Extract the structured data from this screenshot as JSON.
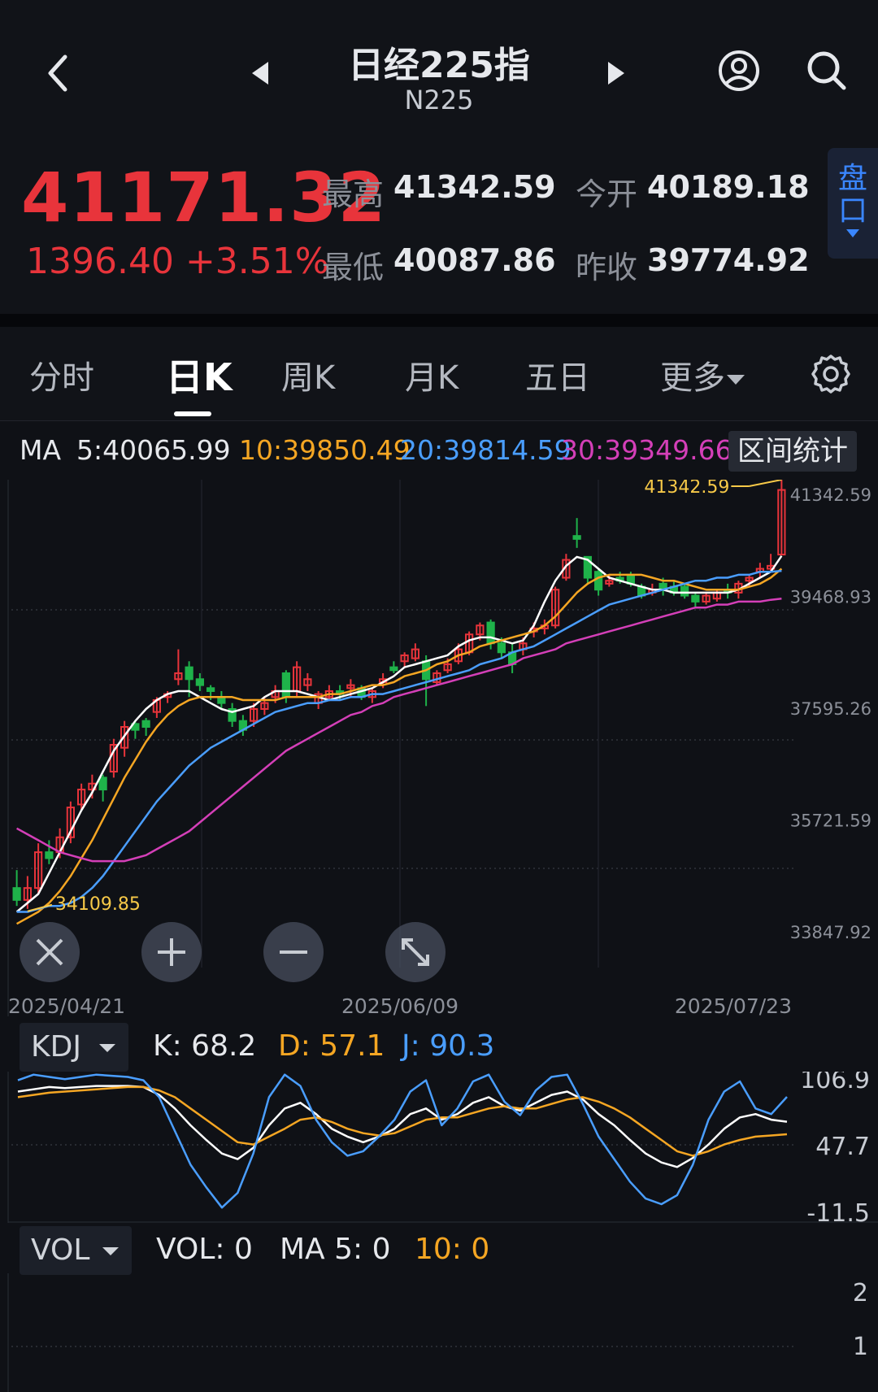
{
  "header": {
    "title": "日经225指",
    "subtitle": "N225"
  },
  "quote": {
    "price": "41171.32",
    "change": "1396.40 +3.51%",
    "high_label": "最高",
    "high": "41342.59",
    "low_label": "最低",
    "low": "40087.86",
    "open_label": "今开",
    "open": "40189.18",
    "prev_label": "昨收",
    "prev": "39774.92",
    "panko_label": "盘口"
  },
  "tabs": [
    "分时",
    "日K",
    "周K",
    "月K",
    "五日",
    "更多"
  ],
  "active_tab": "日K",
  "ma": {
    "label": "MA",
    "ma5": "5:40065.99",
    "ma10": "10:39850.49",
    "ma20": "20:39814.59",
    "ma30": "30:39349.66",
    "range_button": "区间统计"
  },
  "colors": {
    "up": "#e8343b",
    "down": "#1fb34a",
    "ma5": "#ffffff",
    "ma10": "#f5a623",
    "ma20": "#4a9eff",
    "ma30": "#d43fb8",
    "highlight": "#f7c948"
  },
  "icons": [
    "back-icon",
    "prev-arrow-icon",
    "next-arrow-icon",
    "user-icon",
    "search-icon",
    "gear-icon",
    "reset-zoom-icon",
    "zoom-in-icon",
    "zoom-out-icon",
    "fullscreen-icon"
  ],
  "chart_data": [
    {
      "type": "candlestick",
      "title": "日K",
      "y_tick_labels": [
        "41342.59",
        "39468.93",
        "37595.26",
        "35721.59",
        "33847.92"
      ],
      "ylim": [
        33847.92,
        41342.59
      ],
      "x_tick_labels": [
        "2025/04/21",
        "2025/06/09",
        "2025/07/23"
      ],
      "max_label": "41342.59",
      "min_label": "34109.85",
      "candles": [
        [
          34500,
          34300,
          34800,
          34200
        ],
        [
          34300,
          34500,
          34700,
          34150
        ],
        [
          34500,
          35100,
          35250,
          34400
        ],
        [
          35100,
          35000,
          35300,
          34900
        ],
        [
          35100,
          35350,
          35500,
          35000
        ],
        [
          35350,
          35850,
          35950,
          35250
        ],
        [
          35900,
          36150,
          36250,
          35800
        ],
        [
          36150,
          36250,
          36400,
          36000
        ],
        [
          36350,
          36150,
          36400,
          35950
        ],
        [
          36450,
          36900,
          37000,
          36350
        ],
        [
          36850,
          37200,
          37300,
          36700
        ],
        [
          37250,
          37150,
          37300,
          37000
        ],
        [
          37300,
          37200,
          37350,
          37050
        ],
        [
          37450,
          37650,
          37700,
          37350
        ],
        [
          37700,
          37750,
          37800,
          37600
        ],
        [
          38000,
          38100,
          38500,
          37900
        ],
        [
          38200,
          38000,
          38300,
          37700
        ],
        [
          38000,
          37900,
          38100,
          37800
        ],
        [
          37850,
          37800,
          37900,
          37650
        ],
        [
          37700,
          37600,
          37800,
          37500
        ],
        [
          37500,
          37300,
          37600,
          37200
        ],
        [
          37300,
          37150,
          37400,
          37050
        ],
        [
          37300,
          37500,
          37600,
          37200
        ],
        [
          37500,
          37600,
          37700,
          37400
        ],
        [
          37700,
          37800,
          37900,
          37600
        ],
        [
          38100,
          37700,
          38150,
          37600
        ],
        [
          37800,
          38200,
          38300,
          37700
        ],
        [
          37900,
          38000,
          38100,
          37800
        ],
        [
          37600,
          37750,
          37800,
          37500
        ],
        [
          37700,
          37800,
          37900,
          37650
        ],
        [
          37800,
          37750,
          37900,
          37650
        ],
        [
          37850,
          37900,
          38000,
          37700
        ],
        [
          37850,
          37700,
          37900,
          37650
        ],
        [
          37700,
          37800,
          37850,
          37600
        ],
        [
          37950,
          38000,
          38100,
          37850
        ],
        [
          38200,
          38150,
          38300,
          38100
        ],
        [
          38300,
          38400,
          38450,
          38200
        ],
        [
          38350,
          38500,
          38600,
          38300
        ],
        [
          38300,
          38000,
          38400,
          37550
        ],
        [
          37950,
          38100,
          38150,
          37900
        ],
        [
          38150,
          38250,
          38350,
          38100
        ],
        [
          38300,
          38500,
          38600,
          38250
        ],
        [
          38450,
          38750,
          38800,
          38400
        ],
        [
          38750,
          38900,
          38950,
          38650
        ],
        [
          38950,
          38600,
          39000,
          38500
        ],
        [
          38600,
          38450,
          38700,
          38350
        ],
        [
          38450,
          38250,
          38600,
          38100
        ],
        [
          38500,
          38600,
          38700,
          38400
        ],
        [
          38800,
          38850,
          38950,
          38700
        ],
        [
          38850,
          38900,
          39000,
          38750
        ],
        [
          38900,
          39500,
          39550,
          38850
        ],
        [
          39700,
          40000,
          40100,
          39650
        ],
        [
          40400,
          40350,
          40700,
          40200
        ],
        [
          40050,
          39700,
          40050,
          39600
        ],
        [
          39800,
          39500,
          39850,
          39400
        ],
        [
          39600,
          39650,
          39750,
          39550
        ],
        [
          39700,
          39650,
          39800,
          39600
        ],
        [
          39750,
          39600,
          39800,
          39550
        ],
        [
          39550,
          39400,
          39600,
          39350
        ],
        [
          39450,
          39500,
          39600,
          39400
        ],
        [
          39600,
          39500,
          39700,
          39400
        ],
        [
          39550,
          39450,
          39650,
          39400
        ],
        [
          39550,
          39400,
          39600,
          39350
        ],
        [
          39400,
          39300,
          39450,
          39200
        ],
        [
          39300,
          39400,
          39450,
          39250
        ],
        [
          39350,
          39450,
          39500,
          39300
        ],
        [
          39500,
          39450,
          39600,
          39350
        ],
        [
          39450,
          39600,
          39650,
          39350
        ],
        [
          39650,
          39700,
          39750,
          39550
        ],
        [
          39800,
          39850,
          39950,
          39700
        ],
        [
          39850,
          39900,
          40100,
          39800
        ],
        [
          40087.86,
          41171.32,
          41342.59,
          40087.86
        ]
      ],
      "series": [
        {
          "name": "MA5",
          "values": [
            34100,
            34250,
            34400,
            34750,
            35100,
            35450,
            35800,
            36100,
            36450,
            36800,
            37050,
            37300,
            37500,
            37650,
            37750,
            37800,
            37800,
            37700,
            37600,
            37500,
            37450,
            37500,
            37550,
            37700,
            37800,
            37800,
            37800,
            37750,
            37700,
            37650,
            37700,
            37750,
            37800,
            37850,
            37950,
            38050,
            38200,
            38250,
            38300,
            38350,
            38400,
            38550,
            38650,
            38700,
            38700,
            38650,
            38600,
            38650,
            38900,
            39300,
            39650,
            39900,
            40050,
            40000,
            39850,
            39700,
            39650,
            39600,
            39550,
            39500,
            39500,
            39450,
            39450,
            39450,
            39450,
            39450,
            39450,
            39500,
            39600,
            39700,
            39800,
            40065.99
          ]
        },
        {
          "name": "MA10",
          "values": [
            33900,
            34000,
            34100,
            34250,
            34450,
            34700,
            35000,
            35300,
            35650,
            36000,
            36350,
            36650,
            36950,
            37200,
            37400,
            37550,
            37650,
            37700,
            37700,
            37700,
            37700,
            37650,
            37650,
            37650,
            37650,
            37700,
            37700,
            37700,
            37700,
            37750,
            37750,
            37800,
            37850,
            37900,
            37900,
            37950,
            38050,
            38100,
            38150,
            38250,
            38300,
            38400,
            38450,
            38550,
            38600,
            38650,
            38700,
            38750,
            38800,
            38900,
            39050,
            39250,
            39450,
            39600,
            39700,
            39750,
            39750,
            39750,
            39750,
            39700,
            39650,
            39650,
            39600,
            39550,
            39500,
            39500,
            39500,
            39500,
            39550,
            39600,
            39700,
            39850.49
          ]
        },
        {
          "name": "MA20",
          "values": [
            34100,
            34100,
            34150,
            34200,
            34200,
            34250,
            34350,
            34500,
            34700,
            34950,
            35200,
            35450,
            35700,
            35950,
            36150,
            36350,
            36550,
            36700,
            36850,
            36950,
            37050,
            37150,
            37250,
            37350,
            37450,
            37500,
            37550,
            37600,
            37600,
            37650,
            37650,
            37700,
            37700,
            37750,
            37750,
            37800,
            37850,
            37900,
            37950,
            38000,
            38050,
            38100,
            38150,
            38250,
            38300,
            38350,
            38450,
            38500,
            38550,
            38650,
            38750,
            38850,
            38950,
            39050,
            39150,
            39250,
            39300,
            39350,
            39400,
            39450,
            39500,
            39550,
            39600,
            39650,
            39650,
            39700,
            39700,
            39750,
            39750,
            39800,
            39800,
            39814.59
          ]
        },
        {
          "name": "MA30",
          "values": [
            35500,
            35400,
            35300,
            35200,
            35100,
            35050,
            35000,
            34950,
            34950,
            34950,
            34950,
            35000,
            35050,
            35150,
            35250,
            35350,
            35450,
            35600,
            35750,
            35900,
            36050,
            36200,
            36350,
            36500,
            36650,
            36800,
            36900,
            37000,
            37100,
            37200,
            37300,
            37400,
            37450,
            37550,
            37600,
            37700,
            37750,
            37800,
            37850,
            37900,
            37950,
            38000,
            38050,
            38100,
            38150,
            38200,
            38250,
            38350,
            38400,
            38450,
            38500,
            38600,
            38650,
            38700,
            38750,
            38800,
            38850,
            38900,
            38950,
            39000,
            39050,
            39100,
            39150,
            39200,
            39200,
            39250,
            39250,
            39300,
            39300,
            39300,
            39330,
            39349.66
          ]
        }
      ]
    },
    {
      "type": "line",
      "title": "KDJ",
      "selector_label": "KDJ",
      "k_label": "K: 68.2",
      "d_label": "D: 57.1",
      "j_label": "J: 90.3",
      "y_tick_labels": [
        "106.9",
        "47.7",
        "-11.5"
      ],
      "ylim": [
        -11.5,
        106.9
      ],
      "series": [
        {
          "name": "K",
          "values": [
            95,
            97,
            99,
            98,
            99,
            100,
            100,
            100,
            99,
            92,
            80,
            65,
            52,
            40,
            35,
            45,
            65,
            80,
            85,
            75,
            62,
            55,
            50,
            55,
            62,
            75,
            80,
            70,
            75,
            85,
            90,
            82,
            78,
            85,
            92,
            95,
            88,
            75,
            65,
            52,
            40,
            32,
            28,
            36,
            48,
            62,
            72,
            75,
            70,
            68.2
          ]
        },
        {
          "name": "D",
          "values": [
            90,
            92,
            94,
            95,
            96,
            97,
            98,
            99,
            99,
            96,
            90,
            80,
            70,
            60,
            50,
            48,
            55,
            62,
            70,
            72,
            68,
            62,
            58,
            56,
            58,
            64,
            70,
            72,
            72,
            76,
            80,
            82,
            80,
            80,
            84,
            88,
            90,
            86,
            80,
            72,
            62,
            52,
            42,
            38,
            42,
            48,
            52,
            55,
            56,
            57.1
          ]
        },
        {
          "name": "J",
          "values": [
            105,
            110,
            108,
            106,
            108,
            110,
            109,
            108,
            105,
            90,
            60,
            30,
            10,
            -8,
            5,
            40,
            90,
            110,
            100,
            70,
            50,
            38,
            42,
            55,
            70,
            95,
            105,
            65,
            80,
            104,
            110,
            86,
            74,
            96,
            108,
            110,
            84,
            55,
            35,
            15,
            0,
            -5,
            3,
            30,
            70,
            95,
            104,
            80,
            75,
            90.3
          ]
        }
      ]
    },
    {
      "type": "bar",
      "title": "VOL",
      "selector_label": "VOL",
      "vol_label": "VOL: 0",
      "ma5_label": "MA 5: 0",
      "ma10_label": "10: 0",
      "y_tick_labels": [
        "2",
        "1"
      ],
      "ylim": [
        0,
        2
      ],
      "values": []
    }
  ]
}
